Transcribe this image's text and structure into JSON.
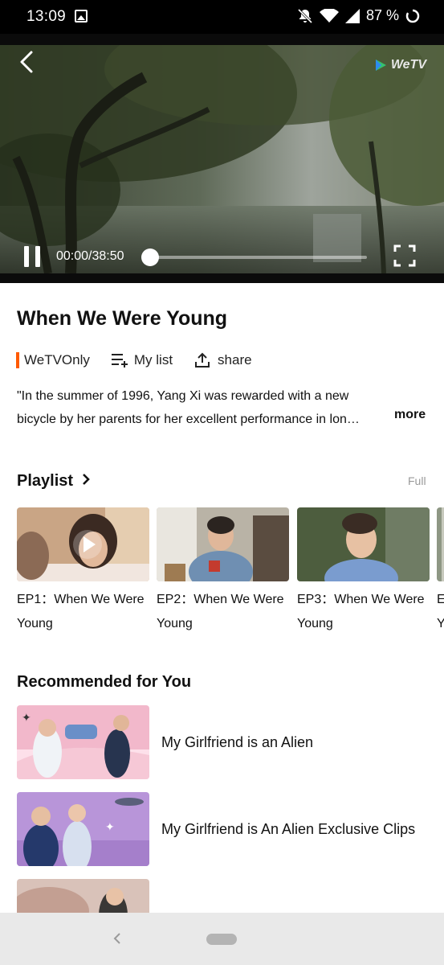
{
  "status_bar": {
    "time": "13:09",
    "battery": "87 %",
    "icons": [
      "image-notification-icon",
      "bell-muted-icon",
      "wifi-icon",
      "signal-icon",
      "battery-icon"
    ]
  },
  "player": {
    "logo_text": "WeTV",
    "timecode": "00:00/38:50",
    "progress": 0,
    "icons": [
      "back-icon",
      "pause-icon",
      "fullscreen-icon"
    ]
  },
  "show": {
    "title": "When We Were Young",
    "tag": "WeTVOnly",
    "my_list_label": "My list",
    "share_label": "share",
    "description_line1": "\"In the summer of 1996, Yang Xi was rewarded with a new",
    "description_line2": "bicycle by her parents for her excellent performance in lon…",
    "more_label": "more"
  },
  "playlist": {
    "title": "Playlist",
    "full_label": "Full",
    "episodes": [
      {
        "line1": "EP1：When We Were",
        "line2": "Young",
        "playing": true
      },
      {
        "line1": "EP2：When We Were",
        "line2": "Young",
        "playing": false
      },
      {
        "line1": "EP3：When We Were",
        "line2": "Young",
        "playing": false
      },
      {
        "line1": "E",
        "line2": "Y",
        "playing": false
      }
    ]
  },
  "recommended": {
    "title": "Recommended for You",
    "items": [
      {
        "title": "My Girlfriend is an Alien"
      },
      {
        "title": "My Girlfriend is An Alien Exclusive Clips"
      },
      {
        "title": ""
      }
    ]
  },
  "colors": {
    "accent_orange": "#ff5a00",
    "status_bar_bg": "#000000",
    "nav_bar_bg": "#e9e9e9",
    "muted_text": "#999999"
  }
}
